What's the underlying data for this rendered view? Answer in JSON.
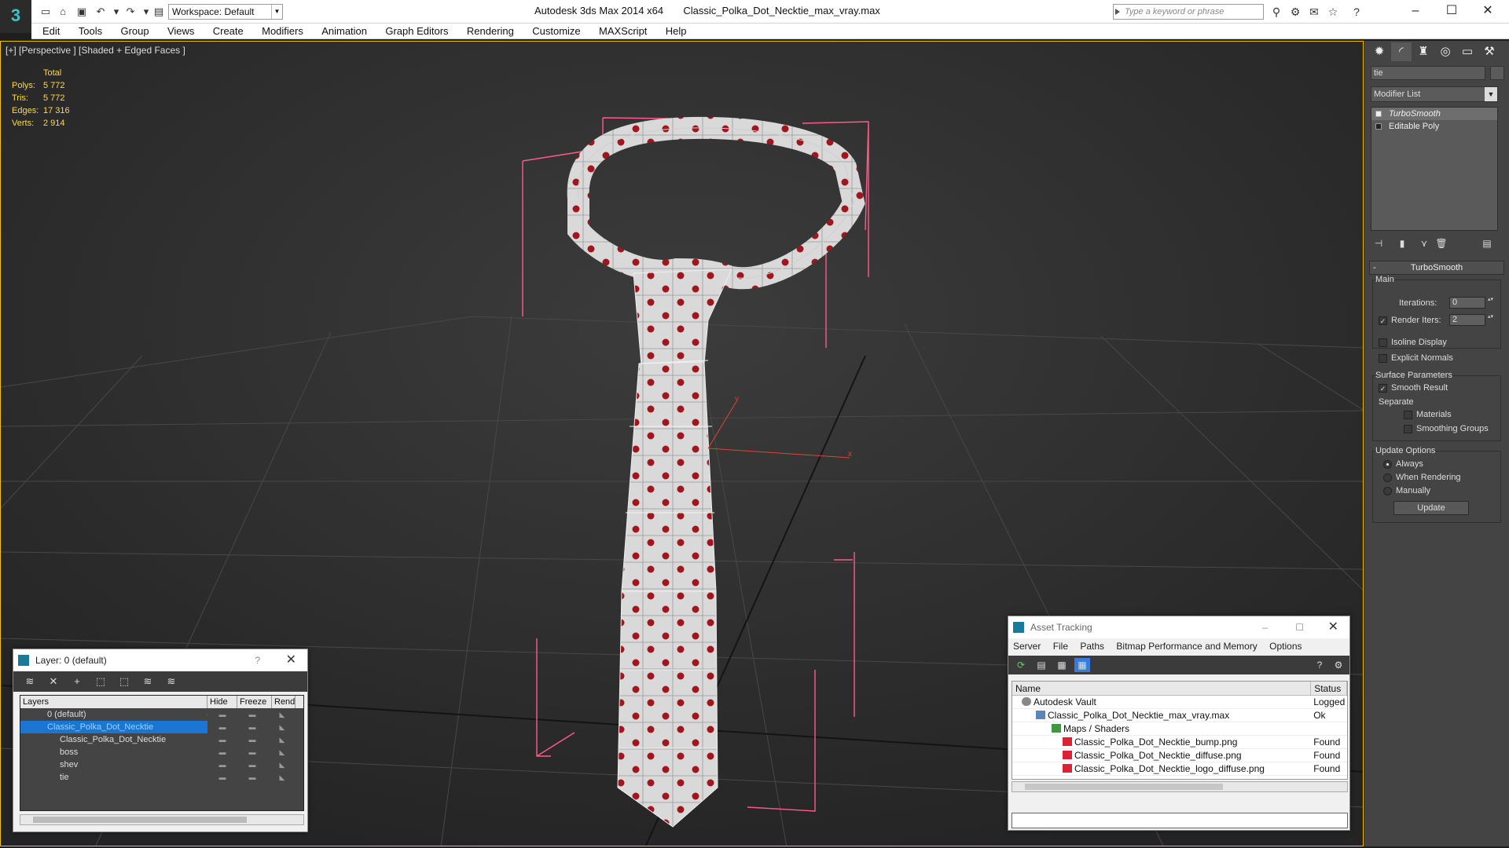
{
  "titlebar": {
    "workspace_label": "Workspace: Default",
    "app_title": "Autodesk 3ds Max  2014 x64",
    "file_title": "Classic_Polka_Dot_Necktie_max_vray.max",
    "search_placeholder": "Type a keyword or phrase"
  },
  "menu": [
    "Edit",
    "Tools",
    "Group",
    "Views",
    "Create",
    "Modifiers",
    "Animation",
    "Graph Editors",
    "Rendering",
    "Customize",
    "MAXScript",
    "Help"
  ],
  "viewport": {
    "label": "[+] [Perspective ] [Shaded + Edged Faces ]",
    "stats": {
      "header": "Total",
      "rows": [
        {
          "k": "Polys:",
          "v": "5 772"
        },
        {
          "k": "Tris:",
          "v": "5 772"
        },
        {
          "k": "Edges:",
          "v": "17 316"
        },
        {
          "k": "Verts:",
          "v": "2 914"
        }
      ]
    },
    "axis_x": "x",
    "axis_y": "y"
  },
  "command_panel": {
    "object_name": "tie",
    "modifier_list": "Modifier List",
    "stack": [
      {
        "label": "TurboSmooth",
        "selected": true
      },
      {
        "label": "Editable Poly",
        "selected": false
      }
    ],
    "rollout_title": "TurboSmooth",
    "main_group": "Main",
    "iterations_label": "Iterations:",
    "iterations_value": "0",
    "render_iters_label": "Render Iters:",
    "render_iters_value": "2",
    "isoline_label": "Isoline Display",
    "explicit_normals_label": "Explicit Normals",
    "surface_group": "Surface Parameters",
    "smooth_result_label": "Smooth Result",
    "separate_label": "Separate",
    "materials_label": "Materials",
    "smoothing_groups_label": "Smoothing Groups",
    "update_group": "Update Options",
    "always_label": "Always",
    "when_rendering_label": "When Rendering",
    "manually_label": "Manually",
    "update_button": "Update"
  },
  "layer_dialog": {
    "title": "Layer: 0 (default)",
    "help": "?",
    "columns": [
      "Layers",
      "Hide",
      "Freeze",
      "Rend"
    ],
    "rows": [
      {
        "name": "0 (default)",
        "indent": 16,
        "selected": false
      },
      {
        "name": "Classic_Polka_Dot_Necktie",
        "indent": 16,
        "selected": true
      },
      {
        "name": "Classic_Polka_Dot_Necktie",
        "indent": 40,
        "selected": false
      },
      {
        "name": "boss",
        "indent": 40,
        "selected": false
      },
      {
        "name": "shev",
        "indent": 40,
        "selected": false
      },
      {
        "name": "tie",
        "indent": 40,
        "selected": false
      }
    ]
  },
  "asset_tracking": {
    "title": "Asset Tracking",
    "menu": [
      "Server",
      "File",
      "Paths",
      "Bitmap Performance and Memory",
      "Options"
    ],
    "columns": [
      "Name",
      "Status"
    ],
    "rows": [
      {
        "name": "Autodesk Vault",
        "status": "Logged",
        "indent": 12,
        "icon": "vault"
      },
      {
        "name": "Classic_Polka_Dot_Necktie_max_vray.max",
        "status": "Ok",
        "indent": 30,
        "icon": "max"
      },
      {
        "name": "Maps / Shaders",
        "status": "",
        "indent": 50,
        "icon": "folder"
      },
      {
        "name": "Classic_Polka_Dot_Necktie_bump.png",
        "status": "Found",
        "indent": 64,
        "icon": "png"
      },
      {
        "name": "Classic_Polka_Dot_Necktie_diffuse.png",
        "status": "Found",
        "indent": 64,
        "icon": "png"
      },
      {
        "name": "Classic_Polka_Dot_Necktie_logo_diffuse.png",
        "status": "Found",
        "indent": 64,
        "icon": "png"
      }
    ]
  }
}
